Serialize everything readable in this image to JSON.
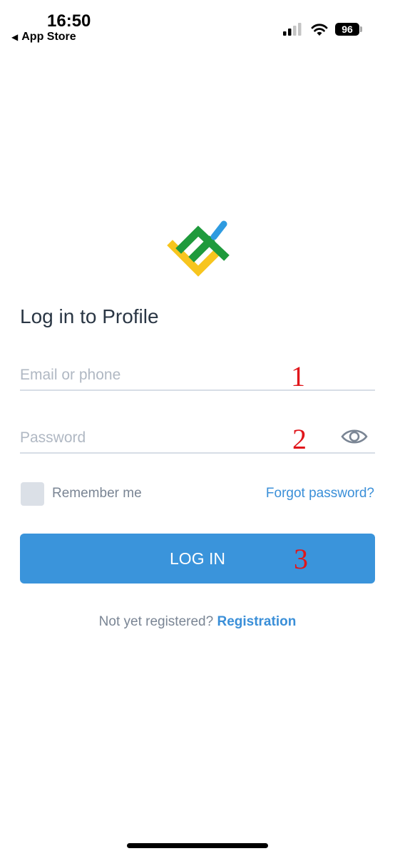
{
  "status_bar": {
    "time": "16:50",
    "back_label": "App Store",
    "battery": "96"
  },
  "login": {
    "title": "Log in to Profile",
    "email_placeholder": "Email or phone",
    "password_placeholder": "Password",
    "remember_label": "Remember me",
    "forgot_label": "Forgot password?",
    "login_button": "LOG IN",
    "register_prompt": "Not yet registered?",
    "register_link": "Registration"
  },
  "annotations": [
    "1",
    "2",
    "3"
  ],
  "colors": {
    "primary": "#3a94db",
    "link": "#3a8fd8",
    "annotation": "#e0161b",
    "logo_green": "#1f9a3c",
    "logo_yellow": "#f7c51e",
    "logo_blue": "#2e9be0"
  },
  "icons": [
    "back-arrow-icon",
    "signal-icon",
    "wifi-icon",
    "battery-icon",
    "brand-logo",
    "eye-icon"
  ]
}
